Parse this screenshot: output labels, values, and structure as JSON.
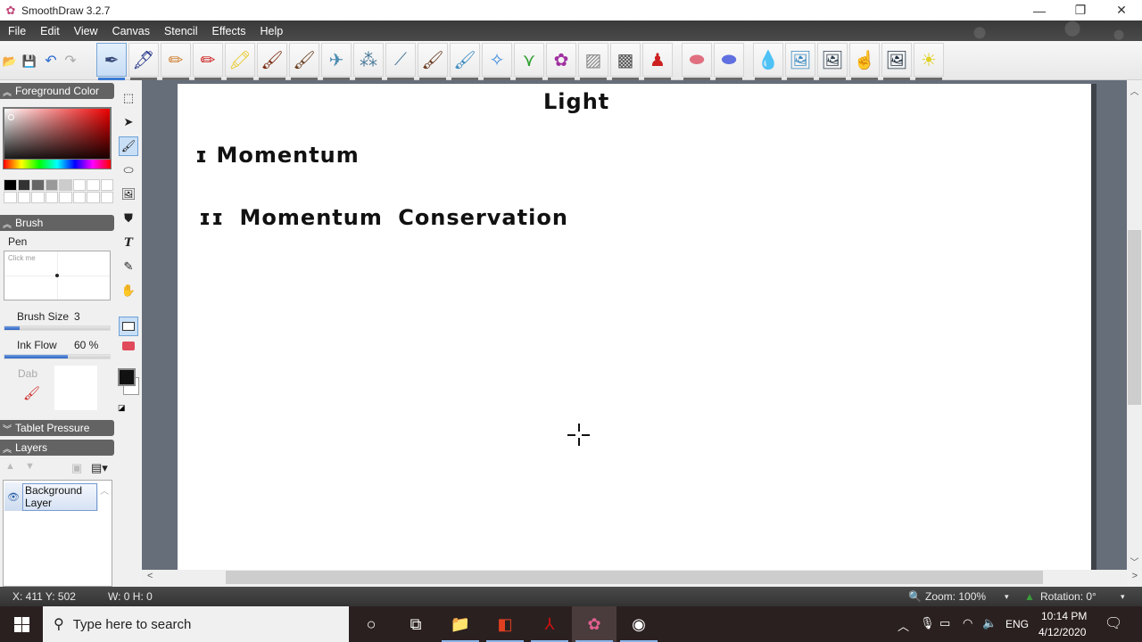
{
  "window": {
    "title": "SmoothDraw 3.2.7",
    "controls": {
      "minimize": "—",
      "restore": "❐",
      "close": "✕"
    }
  },
  "menu": [
    "File",
    "Edit",
    "View",
    "Canvas",
    "Stencil",
    "Effects",
    "Help"
  ],
  "toolbar": {
    "file_buttons": [
      {
        "name": "open-icon",
        "glyph": "📂"
      },
      {
        "name": "save-icon",
        "glyph": "💾"
      },
      {
        "name": "undo-icon",
        "glyph": "↶"
      },
      {
        "name": "redo-icon",
        "glyph": "↷"
      }
    ],
    "brushes": [
      {
        "name": "pen",
        "glyph": "✒",
        "color": "#3a4a7a",
        "active": true
      },
      {
        "name": "ink-pen",
        "glyph": "🖋",
        "color": "#2a3a8a"
      },
      {
        "name": "pencil",
        "glyph": "✏",
        "color": "#d08030"
      },
      {
        "name": "red-pencil",
        "glyph": "✏",
        "color": "#cc2020"
      },
      {
        "name": "highlighter",
        "glyph": "🖍",
        "color": "#e8c820"
      },
      {
        "name": "marker",
        "glyph": "🖌",
        "color": "#7a2a10"
      },
      {
        "name": "brush",
        "glyph": "🖌",
        "color": "#6a4020"
      },
      {
        "name": "airbrush",
        "glyph": "✈",
        "color": "#4a8ab0"
      },
      {
        "name": "spray",
        "glyph": "⁂",
        "color": "#4a7a9a"
      },
      {
        "name": "water-spray",
        "glyph": "⟋",
        "color": "#4a7a9a"
      },
      {
        "name": "oil-brush",
        "glyph": "🖌",
        "color": "#6a3a20"
      },
      {
        "name": "watercolor",
        "glyph": "🖌",
        "color": "#3a8ac0"
      },
      {
        "name": "blur",
        "glyph": "✧",
        "color": "#3a8ae0"
      },
      {
        "name": "grass",
        "glyph": "⋎",
        "color": "#30a030"
      },
      {
        "name": "flowers",
        "glyph": "✿",
        "color": "#a030a0"
      },
      {
        "name": "hatch",
        "glyph": "▨",
        "color": "#888888"
      },
      {
        "name": "halftone",
        "glyph": "▩",
        "color": "#555555"
      },
      {
        "name": "stamp",
        "glyph": "♟",
        "color": "#cc2020"
      },
      {
        "name": "eraser",
        "glyph": "⬬",
        "color": "#e07080"
      },
      {
        "name": "soft-eraser",
        "glyph": "⬬",
        "color": "#6070e0"
      },
      {
        "name": "water-drop",
        "glyph": "💧",
        "color": "#3a8ae0"
      },
      {
        "name": "wet-picture",
        "glyph": "🖼",
        "color": "#3a8ac0"
      },
      {
        "name": "darken-picture",
        "glyph": "🖼",
        "color": "#304050"
      },
      {
        "name": "smudge-finger",
        "glyph": "☝",
        "color": "#f0a040"
      },
      {
        "name": "burn-picture",
        "glyph": "🖼",
        "color": "#203040"
      },
      {
        "name": "lighten-picture",
        "glyph": "☀",
        "color": "#e0d020"
      }
    ]
  },
  "panels": {
    "foreground": {
      "header": "Foreground Color",
      "swatches": [
        "#000000",
        "#333333",
        "#666666",
        "#999999",
        "#cccccc",
        "#ffffff",
        "#ffffff",
        "#ffffff",
        "#ffffff",
        "#ffffff",
        "#ffffff",
        "#ffffff",
        "#ffffff",
        "#ffffff",
        "#ffffff",
        "#ffffff"
      ]
    },
    "brush": {
      "header": "Brush",
      "name": "Pen",
      "preview_hint": "Click me",
      "size_label": "Brush Size",
      "size_value": "3",
      "size_fraction": 0.14,
      "flow_label": "Ink Flow",
      "flow_value": "60 %",
      "flow_fraction": 0.6,
      "dab_label": "Dab"
    },
    "tablet": {
      "header": "Tablet Pressure"
    },
    "layers": {
      "header": "Layers",
      "items": [
        {
          "name": "Background Layer",
          "visible": true
        }
      ]
    }
  },
  "tools": [
    {
      "name": "select-rect-icon",
      "glyph": "⬚"
    },
    {
      "name": "move-icon",
      "glyph": "➤"
    },
    {
      "name": "brush-tool-icon",
      "glyph": "🖌",
      "active": true
    },
    {
      "name": "eraser-tool-icon",
      "glyph": "⬭"
    },
    {
      "name": "image-tool-icon",
      "glyph": "🖼"
    },
    {
      "name": "fill-icon",
      "glyph": "⛊"
    },
    {
      "name": "text-tool-icon",
      "glyph": "T"
    },
    {
      "name": "eyedropper-icon",
      "glyph": "✎"
    },
    {
      "name": "hand-icon",
      "glyph": "✋"
    }
  ],
  "colors": {
    "foreground": "#111111",
    "background": "#ffffff"
  },
  "canvas": {
    "handwriting": [
      {
        "text": "Light"
      },
      {
        "text": "ɪ Momentum"
      },
      {
        "text": "ɪɪ Momentum  Conservation"
      }
    ]
  },
  "status": {
    "position": "X: 411 Y: 502",
    "size": "W: 0 H: 0",
    "zoom": "Zoom: 100%",
    "rotation": "Rotation: 0°"
  },
  "taskbar": {
    "search_placeholder": "Type here to search",
    "apps": [
      {
        "name": "cortana-icon",
        "glyph": "○"
      },
      {
        "name": "task-view-icon",
        "glyph": "⧉"
      },
      {
        "name": "file-explorer-icon",
        "glyph": "📁"
      },
      {
        "name": "office-icon",
        "glyph": "◧"
      },
      {
        "name": "acrobat-icon",
        "glyph": "⅄"
      },
      {
        "name": "smoothdraw-icon",
        "glyph": "✿",
        "active": true
      },
      {
        "name": "obs-icon",
        "glyph": "◉"
      }
    ],
    "tray": {
      "language": "ENG",
      "time": "10:14 PM",
      "date": "4/12/2020"
    }
  }
}
